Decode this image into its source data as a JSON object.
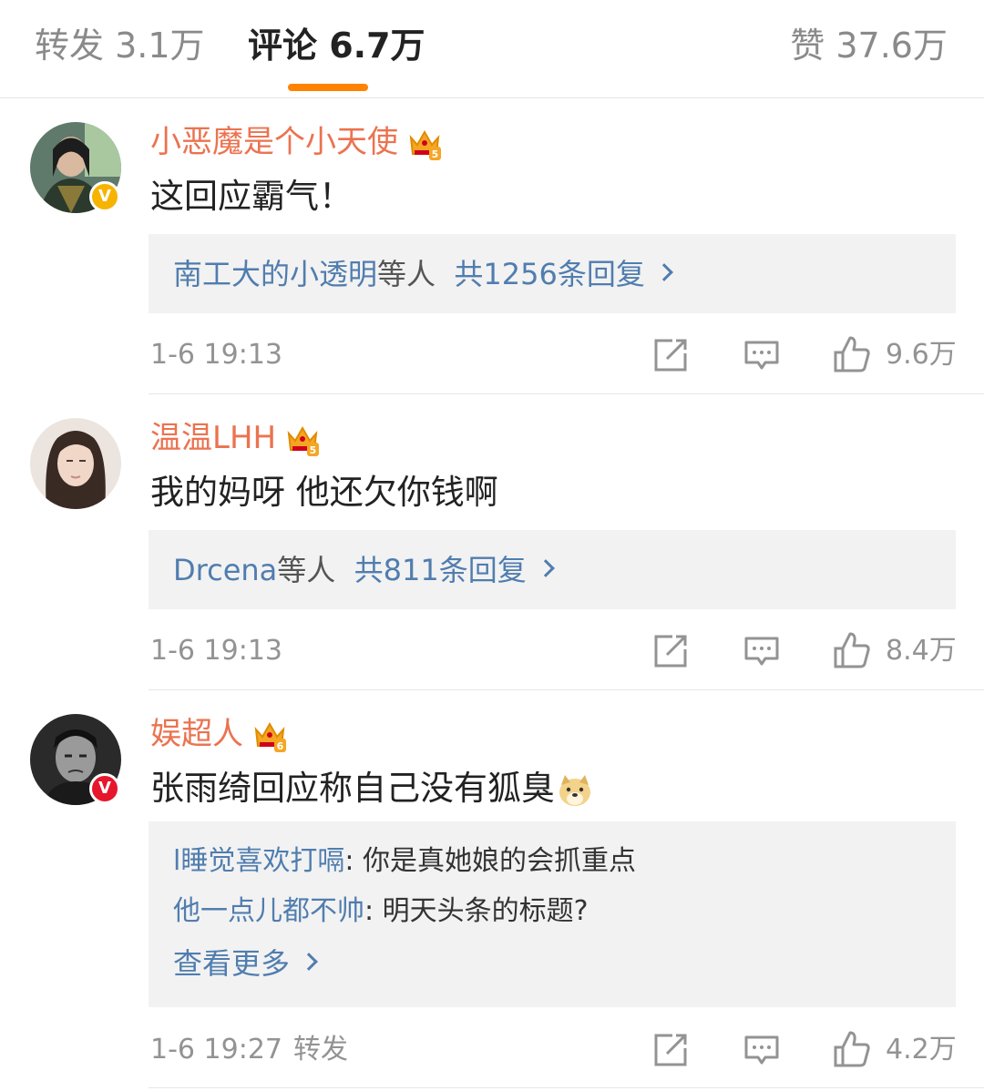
{
  "tabs": {
    "repost": "转发 3.1万",
    "comments": "评论 6.7万",
    "likes": "赞 37.6万"
  },
  "colors": {
    "accent": "#ff8200",
    "username": "#eb7350",
    "link": "#507daf"
  },
  "comments": [
    {
      "username": "小恶魔是个小天使",
      "badge": "crown-5",
      "verified": "gold",
      "text": "这回应霸气！",
      "reply_users": "南工大的小透明",
      "reply_others": "等人",
      "reply_count": "共1256条回复",
      "time": "1-6 19:13",
      "likes": "9.6万"
    },
    {
      "username": "温温LHH",
      "badge": "crown-5",
      "text": "我的妈呀 他还欠你钱啊",
      "reply_users": "Drcena",
      "reply_others": "等人",
      "reply_count": "共811条回复",
      "time": "1-6 19:13",
      "likes": "8.4万"
    },
    {
      "username": "娱超人",
      "badge": "crown-6",
      "verified": "red",
      "text": "张雨绮回应称自己没有狐臭",
      "emoji": "doge-emoji",
      "sub_replies": [
        {
          "user": "l睡觉喜欢打嗝",
          "text": ": 你是真她娘的会抓重点"
        },
        {
          "user": "他一点儿都不帅",
          "text": ": 明天头条的标题?"
        }
      ],
      "view_more": "查看更多",
      "time": "1-6 19:27",
      "forward_label": "转发",
      "likes": "4.2万"
    }
  ]
}
